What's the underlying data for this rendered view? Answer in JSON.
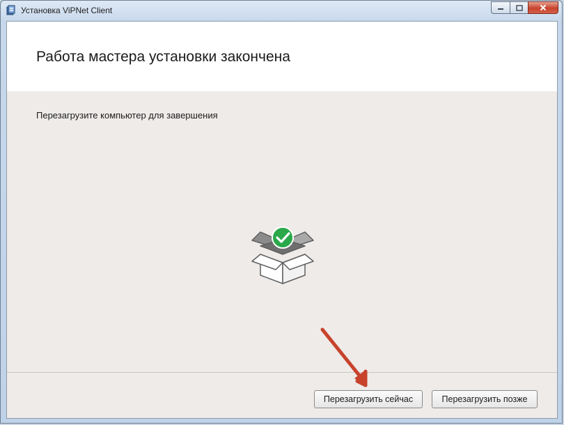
{
  "window": {
    "title": "Установка ViPNet Client",
    "icon": "installer-icon",
    "controls": [
      "minimize",
      "maximize",
      "close"
    ]
  },
  "header": {
    "title": "Работа мастера установки закончена"
  },
  "main": {
    "message": "Перезагрузите компьютер для завершения",
    "illustration": "open-box-with-checkmark-icon"
  },
  "footer": {
    "restart_now_label": "Перезагрузить сейчас",
    "restart_later_label": "Перезагрузить позже"
  },
  "colors": {
    "accent_check": "#28a745",
    "annotation_arrow": "#c8432c",
    "content_background": "#eeebe9"
  }
}
